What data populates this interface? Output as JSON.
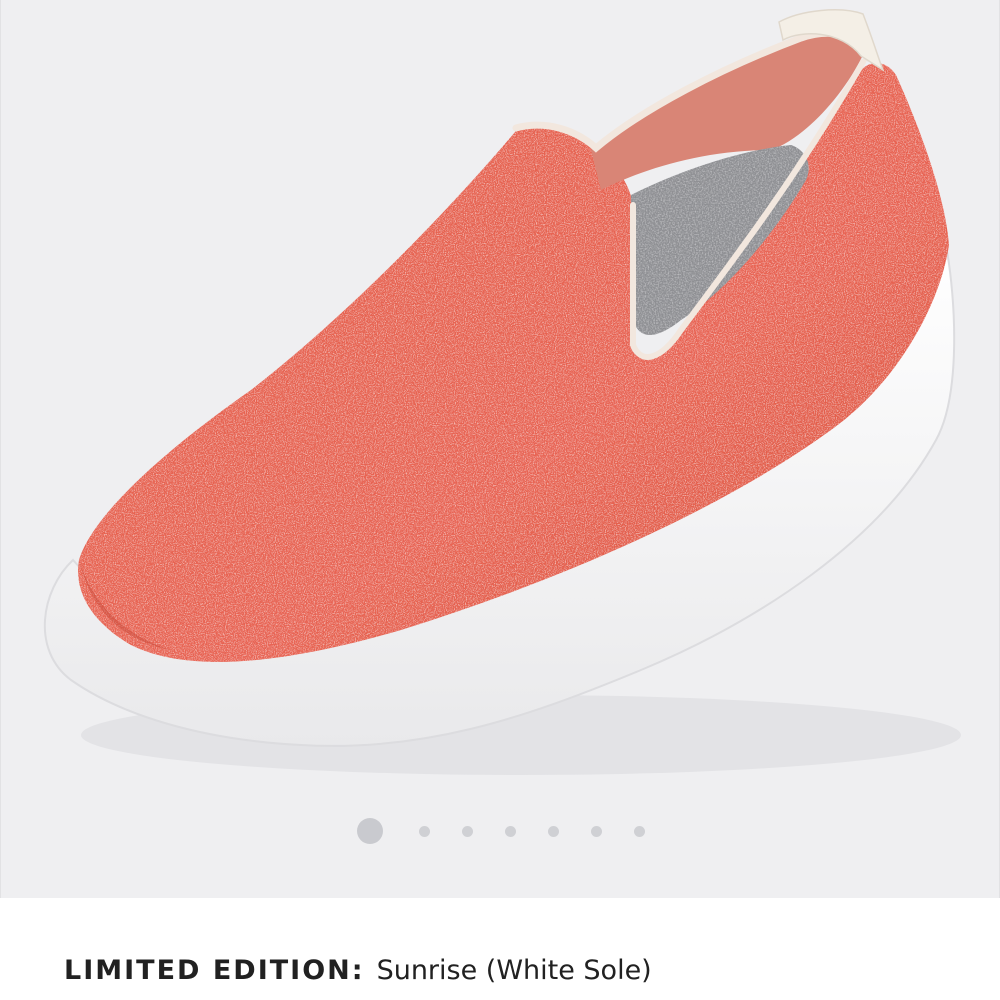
{
  "product": {
    "image_alt": "Red wool slip-on shoe with white sole",
    "colors": {
      "upper": "#e8614f",
      "upper_dark": "#d24a3b",
      "sole": "#ffffff",
      "insole": "#8d8e92",
      "lining": "#d88474",
      "background": "#efeff1"
    }
  },
  "carousel": {
    "count": 7,
    "active_index": 0
  },
  "details": {
    "edition_label": "LIMITED EDITION:",
    "color_name": "Sunrise (White Sole)"
  }
}
